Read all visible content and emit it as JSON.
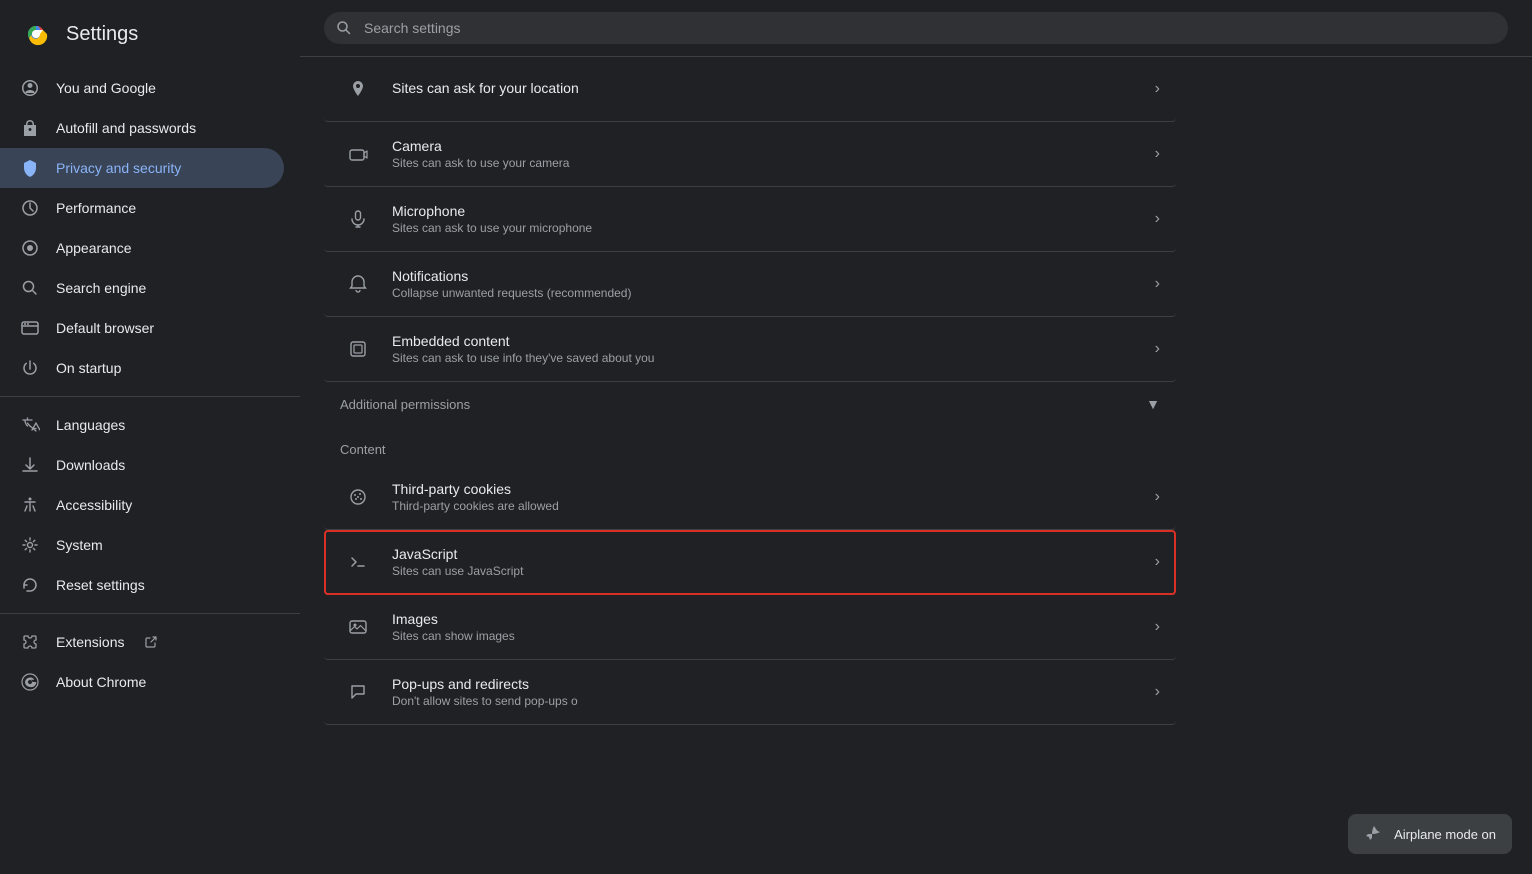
{
  "sidebar": {
    "title": "Settings",
    "items": [
      {
        "id": "you-and-google",
        "label": "You and Google",
        "icon": "google"
      },
      {
        "id": "autofill",
        "label": "Autofill and passwords",
        "icon": "autofill"
      },
      {
        "id": "privacy",
        "label": "Privacy and security",
        "icon": "shield",
        "active": true
      },
      {
        "id": "performance",
        "label": "Performance",
        "icon": "performance"
      },
      {
        "id": "appearance",
        "label": "Appearance",
        "icon": "appearance"
      },
      {
        "id": "search-engine",
        "label": "Search engine",
        "icon": "search"
      },
      {
        "id": "default-browser",
        "label": "Default browser",
        "icon": "browser"
      },
      {
        "id": "on-startup",
        "label": "On startup",
        "icon": "startup"
      },
      {
        "id": "languages",
        "label": "Languages",
        "icon": "languages"
      },
      {
        "id": "downloads",
        "label": "Downloads",
        "icon": "downloads"
      },
      {
        "id": "accessibility",
        "label": "Accessibility",
        "icon": "accessibility"
      },
      {
        "id": "system",
        "label": "System",
        "icon": "system"
      },
      {
        "id": "reset-settings",
        "label": "Reset settings",
        "icon": "reset"
      },
      {
        "id": "extensions",
        "label": "Extensions",
        "icon": "extensions",
        "external": true
      },
      {
        "id": "about-chrome",
        "label": "About Chrome",
        "icon": "about"
      }
    ]
  },
  "search": {
    "placeholder": "Search settings"
  },
  "main": {
    "rows": [
      {
        "id": "location",
        "title": "Sites can ask for your location",
        "subtitle": "",
        "icon": "location",
        "hasArrow": true
      },
      {
        "id": "camera",
        "title": "Camera",
        "subtitle": "Sites can ask to use your camera",
        "icon": "camera",
        "hasArrow": true
      },
      {
        "id": "microphone",
        "title": "Microphone",
        "subtitle": "Sites can ask to use your microphone",
        "icon": "microphone",
        "hasArrow": true
      },
      {
        "id": "notifications",
        "title": "Notifications",
        "subtitle": "Collapse unwanted requests (recommended)",
        "icon": "notifications",
        "hasArrow": true
      },
      {
        "id": "embedded-content",
        "title": "Embedded content",
        "subtitle": "Sites can ask to use info they've saved about you",
        "icon": "embedded",
        "hasArrow": true
      }
    ],
    "additional_permissions": {
      "label": "Additional permissions",
      "chevron": "▾"
    },
    "content_section": {
      "label": "Content",
      "rows": [
        {
          "id": "third-party-cookies",
          "title": "Third-party cookies",
          "subtitle": "Third-party cookies are allowed",
          "icon": "cookies",
          "hasArrow": true
        },
        {
          "id": "javascript",
          "title": "JavaScript",
          "subtitle": "Sites can use JavaScript",
          "icon": "javascript",
          "hasArrow": true,
          "highlighted": true
        },
        {
          "id": "images",
          "title": "Images",
          "subtitle": "Sites can show images",
          "icon": "images",
          "hasArrow": true
        },
        {
          "id": "popups",
          "title": "Pop-ups and redirects",
          "subtitle": "Don't allow sites to send pop-ups o",
          "icon": "popups",
          "hasArrow": true
        }
      ]
    }
  }
}
